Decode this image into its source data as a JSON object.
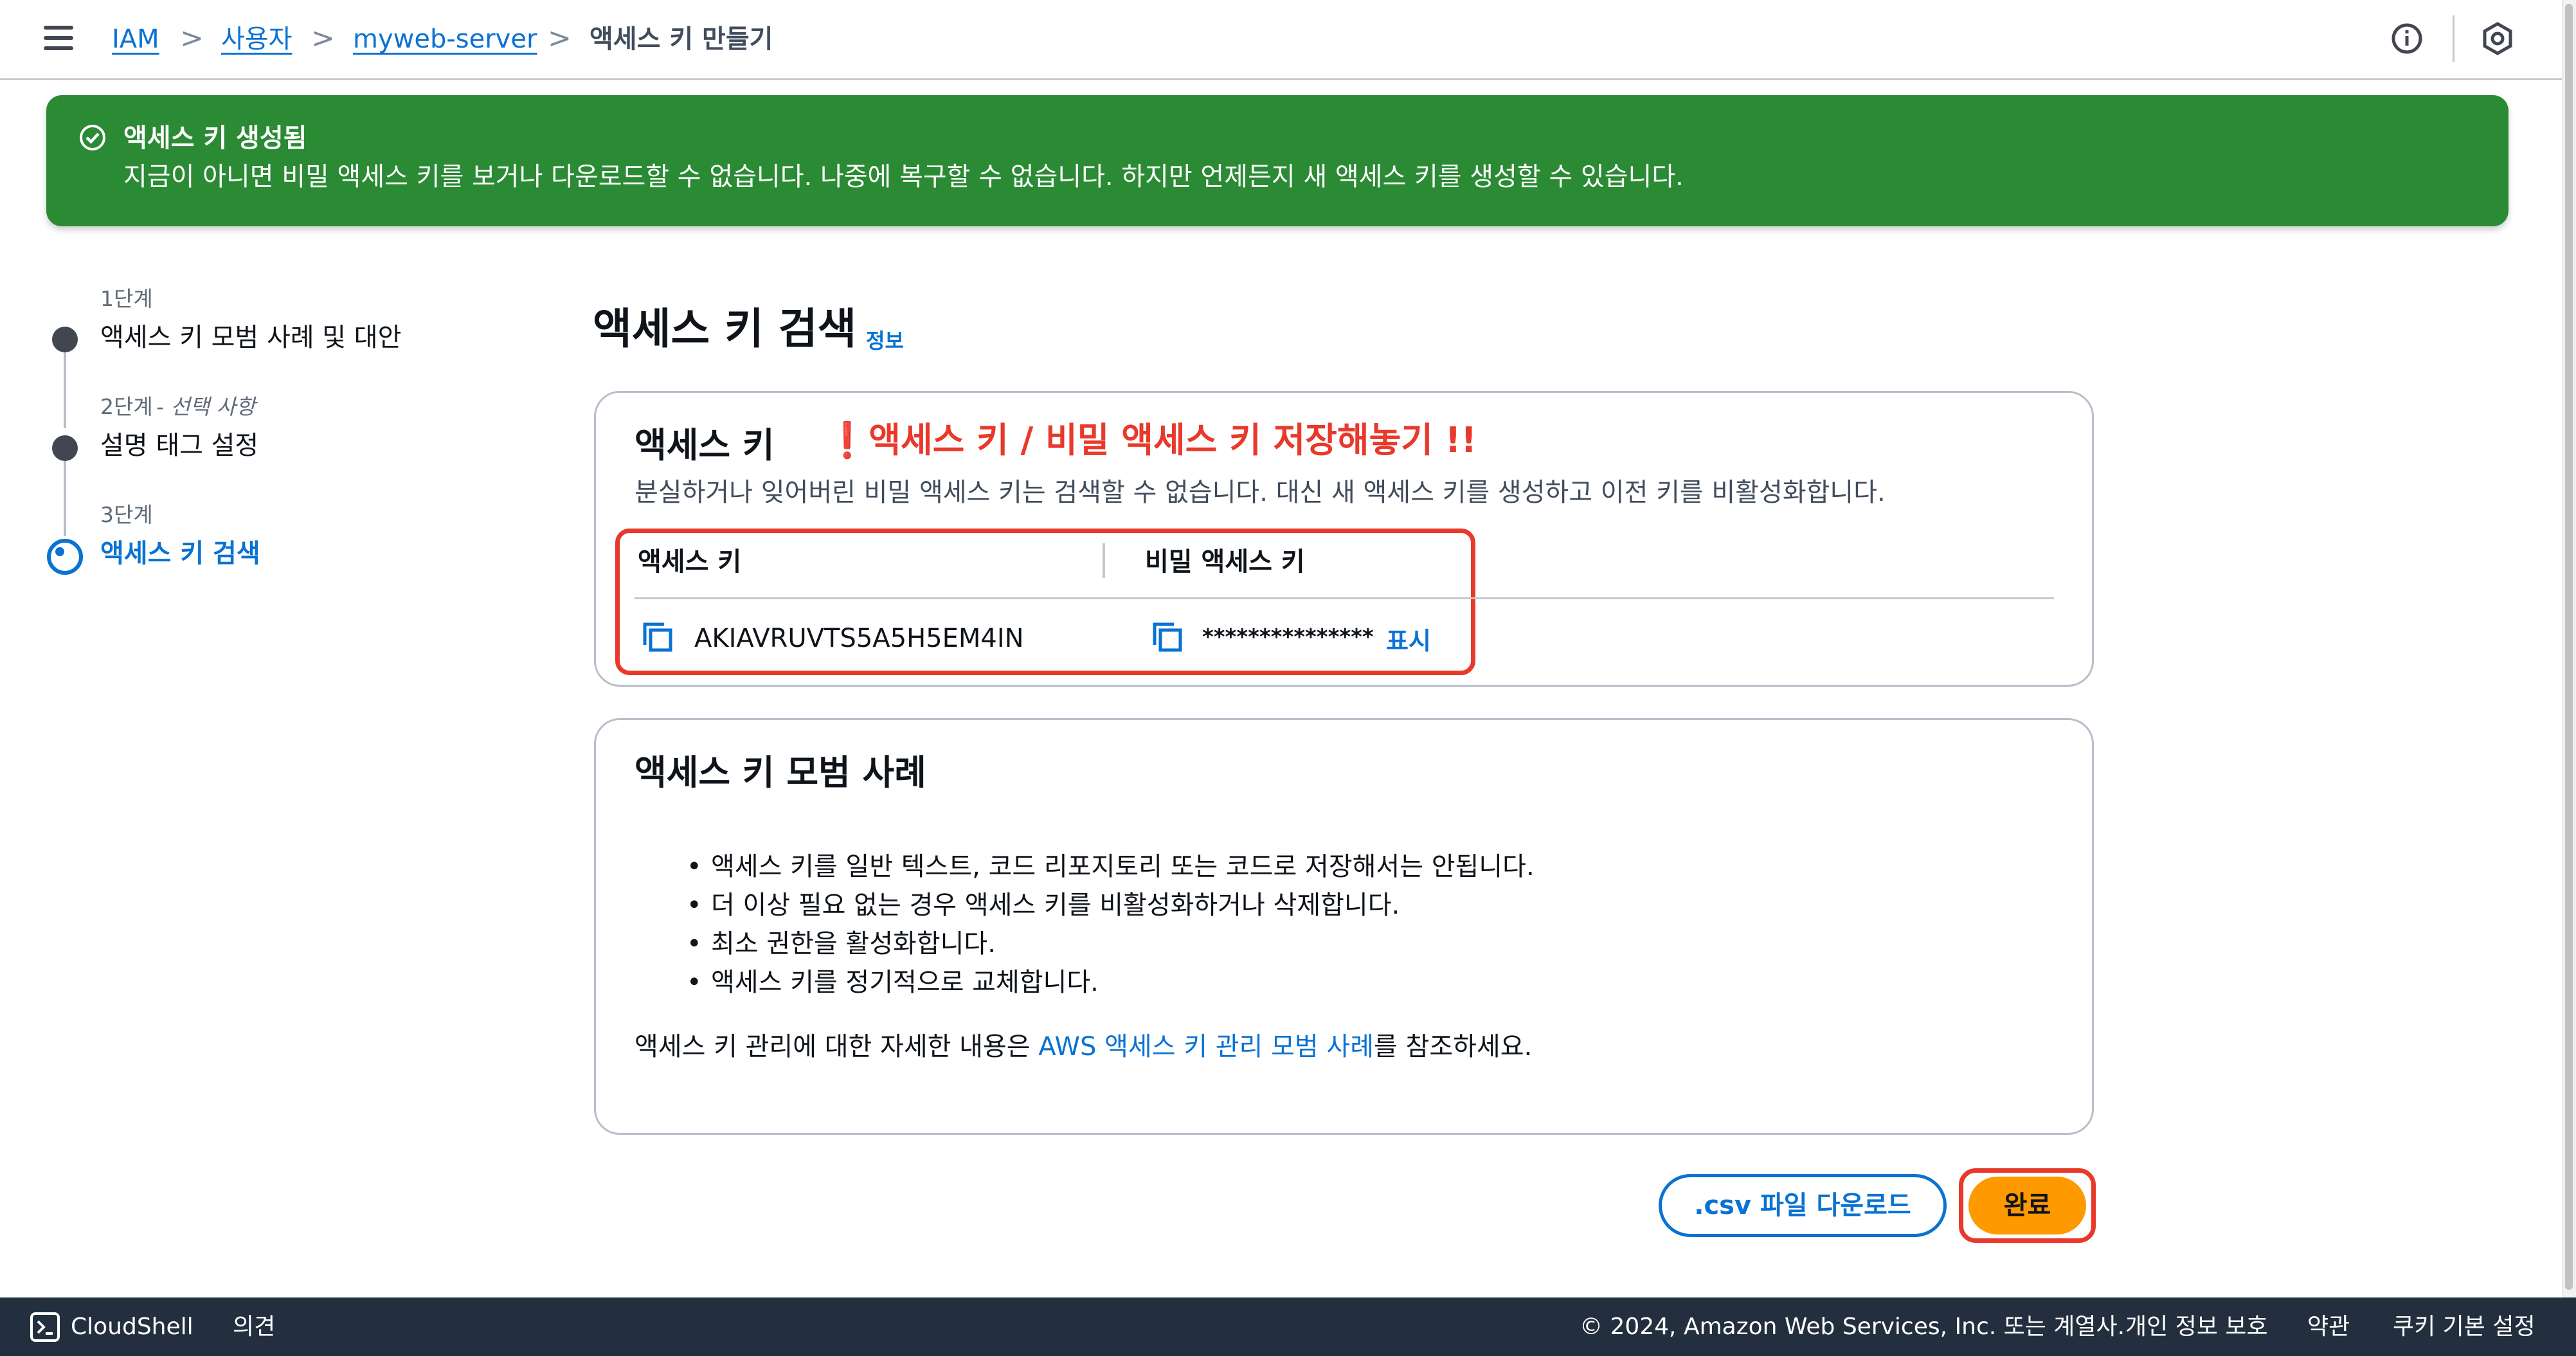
{
  "breadcrumb": {
    "items": [
      "IAM",
      "사용자",
      "myweb-server"
    ],
    "current": "액세스 키 만들기",
    "separator": ">"
  },
  "flash": {
    "title": "액세스 키 생성됨",
    "message": "지금이 아니면 비밀 액세스 키를 보거나 다운로드할 수 없습니다. 나중에 복구할 수 없습니다. 하지만 언제든지 새 액세스 키를 생성할 수 있습니다.",
    "color": "#2b8a34"
  },
  "steps": [
    {
      "label": "1단계",
      "title": "액세스 키 모범 사례 및 대안"
    },
    {
      "label": "2단계",
      "optional": "- 선택 사항",
      "title": "설명 태그 설정"
    },
    {
      "label": "3단계",
      "title": "액세스 키 검색"
    }
  ],
  "page": {
    "title": "액세스 키 검색",
    "info_link": "정보"
  },
  "access_key_card": {
    "heading": "액세스 키",
    "annotation": "❗액세스 키 / 비밀 액세스 키 저장해놓기 !!",
    "description": "분실하거나 잊어버린 비밀 액세스 키는 검색할 수 없습니다. 대신 새 액세스 키를 생성하고 이전 키를 비활성화합니다.",
    "columns": [
      "액세스 키",
      "비밀 액세스 키"
    ],
    "access_key_value": "AKIAVRUVTS5A5H5EM4IN",
    "secret_key_masked": "***************",
    "show_label": "표시"
  },
  "best_practices": {
    "heading": "액세스 키 모범 사례",
    "bullets": [
      "액세스 키를 일반 텍스트, 코드 리포지토리 또는 코드로 저장해서는 안됩니다.",
      "더 이상 필요 없는 경우 액세스 키를 비활성화하거나 삭제합니다.",
      "최소 권한을 활성화합니다.",
      "액세스 키를 정기적으로 교체합니다."
    ],
    "ref_prefix": "액세스 키 관리에 대한 자세한 내용은 ",
    "ref_link": "AWS 액세스 키 관리 모범 사례",
    "ref_suffix": "를 참조하세요."
  },
  "buttons": {
    "download_csv": ".csv 파일 다운로드",
    "done": "완료"
  },
  "footer": {
    "cloudshell": "CloudShell",
    "feedback": "의견",
    "copyright": "© 2024, Amazon Web Services, Inc. 또는 계열사.",
    "privacy": "개인 정보 보호",
    "terms": "약관",
    "cookies": "쿠키 기본 설정"
  },
  "colors": {
    "link": "#0972d3",
    "primary_button": "#ff9900",
    "annotation_red": "#e8392b",
    "footer_bg": "#232f3e"
  },
  "icons": [
    "menu-icon",
    "info-icon",
    "notifications-icon",
    "success-check-icon",
    "copy-icon",
    "terminal-icon"
  ]
}
